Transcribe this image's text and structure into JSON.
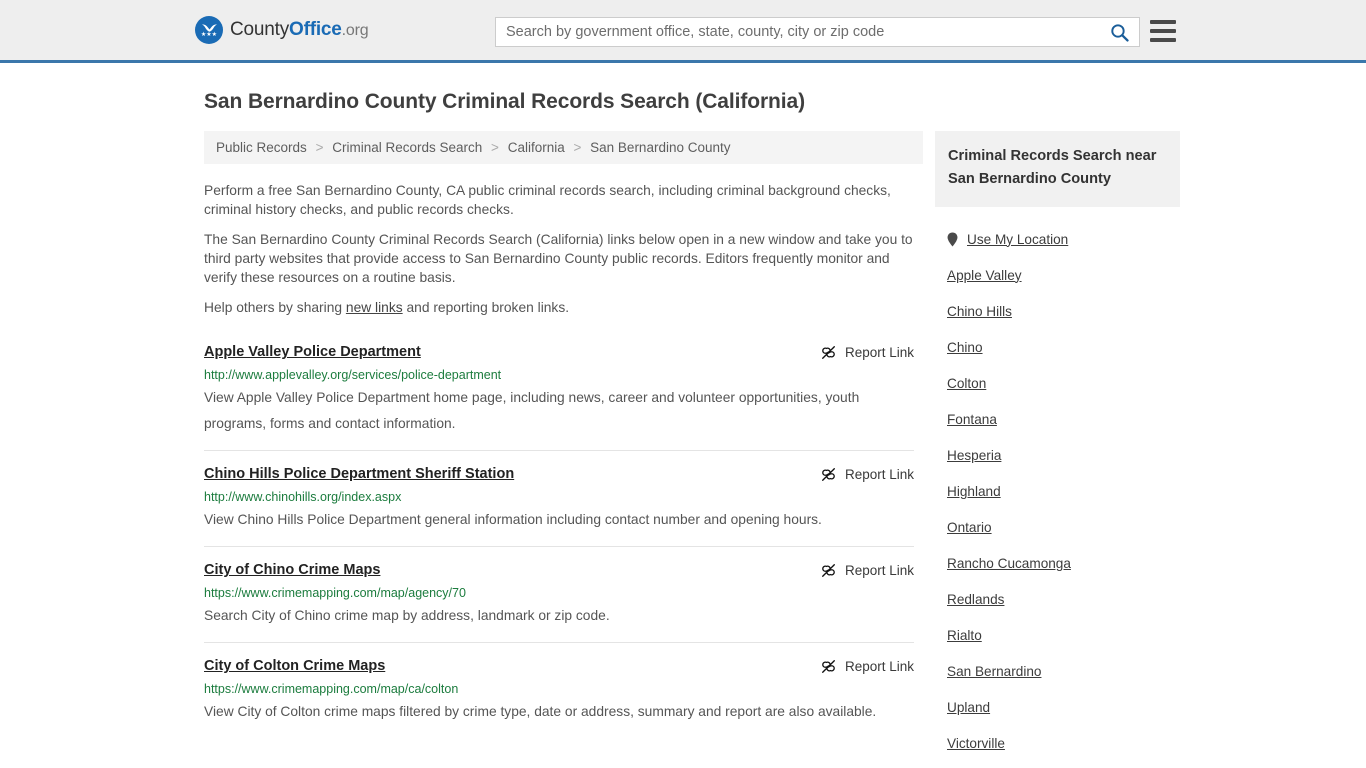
{
  "header": {
    "brand": {
      "part1": "County",
      "part2": "Office",
      "part3": ".org",
      "logo_icon": "eagle-seal-icon",
      "stars": "★★★"
    },
    "search": {
      "placeholder": "Search by government office, state, county, city or zip code",
      "value": "",
      "icon": "search-icon"
    },
    "menu_icon": "hamburger-menu-icon",
    "accent_color": "#3b77ab"
  },
  "page": {
    "title": "San Bernardino County Criminal Records Search (California)"
  },
  "breadcrumb": {
    "separator": ">",
    "items": [
      "Public Records",
      "Criminal Records Search",
      "California",
      "San Bernardino County"
    ]
  },
  "intro": {
    "paragraph1": "Perform a free San Bernardino County, CA public criminal records search, including criminal background checks, criminal history checks, and public records checks.",
    "paragraph2": "The San Bernardino County Criminal Records Search (California) links below open in a new window and take you to third party websites that provide access to San Bernardino County public records. Editors frequently monitor and verify these resources on a routine basis.",
    "paragraph3_before": "Help others by sharing ",
    "paragraph3_link": "new links",
    "paragraph3_after": " and reporting broken links."
  },
  "report_link": {
    "label": "Report Link",
    "icon": "broken-link-icon"
  },
  "listings": [
    {
      "title": "Apple Valley Police Department",
      "url": "http://www.applevalley.org/services/police-department",
      "description": "View Apple Valley Police Department home page, including news, career and volunteer opportunities, youth programs, forms and contact information."
    },
    {
      "title": "Chino Hills Police Department Sheriff Station",
      "url": "http://www.chinohills.org/index.aspx",
      "description": "View Chino Hills Police Department general information including contact number and opening hours."
    },
    {
      "title": "City of Chino Crime Maps",
      "url": "https://www.crimemapping.com/map/agency/70",
      "description": "Search City of Chino crime map by address, landmark or zip code."
    },
    {
      "title": "City of Colton Crime Maps",
      "url": "https://www.crimemapping.com/map/ca/colton",
      "description": "View City of Colton crime maps filtered by crime type, date or address, summary and report are also available."
    }
  ],
  "sidebar": {
    "heading": "Criminal Records Search near San Bernardino County",
    "location_link": {
      "label": "Use My Location",
      "icon": "map-pin-icon"
    },
    "cities": [
      "Apple Valley",
      "Chino Hills",
      "Chino",
      "Colton",
      "Fontana",
      "Hesperia",
      "Highland",
      "Ontario",
      "Rancho Cucamonga",
      "Redlands",
      "Rialto",
      "San Bernardino",
      "Upland",
      "Victorville"
    ]
  }
}
